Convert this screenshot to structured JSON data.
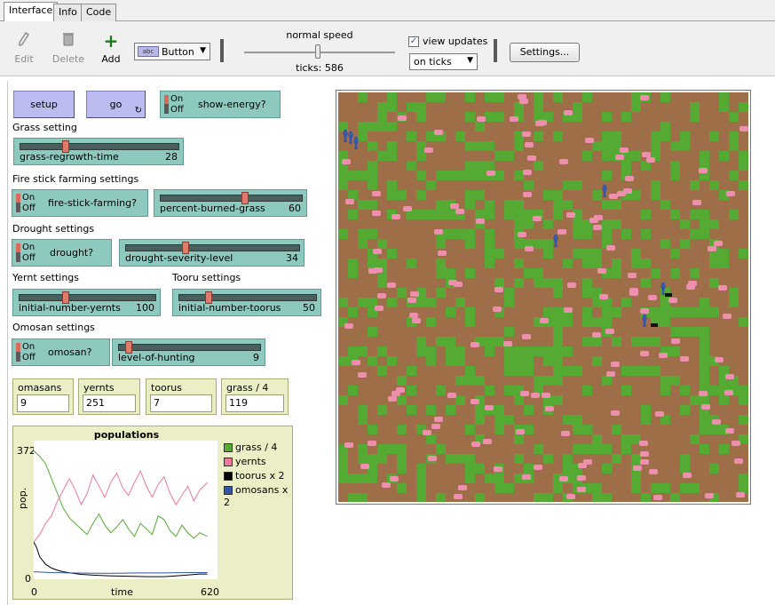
{
  "tabs": [
    {
      "label": "Interface",
      "active": true
    },
    {
      "label": "Info",
      "active": false
    },
    {
      "label": "Code",
      "active": false
    }
  ],
  "toolbar": {
    "edit_label": "Edit",
    "delete_label": "Delete",
    "add_label": "Add",
    "add_icon": "+",
    "widget_type": "Button",
    "widget_icon_text": "abc",
    "speed_label": "normal speed",
    "ticks_label": "ticks: 586",
    "view_updates_label": "view updates",
    "view_updates_checked": true,
    "update_mode": "on ticks",
    "settings_label": "Settings..."
  },
  "controls": {
    "setup_label": "setup",
    "go_label": "go",
    "show_energy": {
      "name": "show-energy?",
      "on": "On",
      "off": "Off"
    },
    "grass_note": "Grass setting",
    "grass_regrowth": {
      "name": "grass-regrowth-time",
      "value": "28",
      "fraction": 0.28
    },
    "fire_note": "Fire stick farming settings",
    "fire_stick": {
      "name": "fire-stick-farming?",
      "on": "On",
      "off": "Off"
    },
    "percent_burned": {
      "name": "percent-burned-grass",
      "value": "60",
      "fraction": 0.6
    },
    "drought_note": "Drought settings",
    "drought": {
      "name": "drought?",
      "on": "On",
      "off": "Off"
    },
    "drought_severity": {
      "name": "drought-severity-level",
      "value": "34",
      "fraction": 0.34
    },
    "yernt_note": "Yernt settings",
    "tooru_note": "Tooru settings",
    "initial_yernts": {
      "name": "initial-number-yernts",
      "value": "100",
      "fraction": 0.33
    },
    "initial_toorus": {
      "name": "initial-number-toorus",
      "value": "50",
      "fraction": 0.2
    },
    "omosan_note": "Omosan settings",
    "omosan": {
      "name": "omosan?",
      "on": "On",
      "off": "Off"
    },
    "level_hunting": {
      "name": "level-of-hunting",
      "value": "9",
      "fraction": 0.05
    }
  },
  "monitors": [
    {
      "name": "omasans",
      "value": "9"
    },
    {
      "name": "yernts",
      "value": "251"
    },
    {
      "name": "toorus",
      "value": "7"
    },
    {
      "name": "grass / 4",
      "value": "119"
    }
  ],
  "chart_data": {
    "type": "line",
    "title": "populations",
    "xlabel": "time",
    "ylabel": "pop.",
    "xlim": [
      0,
      620
    ],
    "ylim": [
      0,
      372
    ],
    "x_tick_labels": [
      "0",
      "620"
    ],
    "y_tick_labels": [
      "0",
      "372"
    ],
    "legend_position": "right",
    "series": [
      {
        "name": "grass / 4",
        "color": "#55aa33",
        "x": [
          0,
          20,
          40,
          60,
          80,
          100,
          120,
          140,
          160,
          180,
          200,
          220,
          240,
          260,
          280,
          300,
          320,
          340,
          360,
          380,
          400,
          420,
          440,
          460,
          480,
          500,
          520,
          540,
          560,
          586
        ],
        "y": [
          345,
          330,
          310,
          270,
          230,
          190,
          165,
          150,
          135,
          120,
          150,
          175,
          145,
          125,
          140,
          160,
          135,
          115,
          150,
          135,
          120,
          170,
          160,
          130,
          115,
          145,
          125,
          110,
          125,
          115
        ]
      },
      {
        "name": "yernts",
        "color": "#ee7799",
        "x": [
          0,
          20,
          40,
          60,
          80,
          100,
          120,
          140,
          160,
          180,
          200,
          220,
          240,
          260,
          280,
          300,
          320,
          340,
          360,
          380,
          400,
          420,
          440,
          460,
          480,
          500,
          520,
          540,
          560,
          586
        ],
        "y": [
          100,
          120,
          150,
          170,
          210,
          240,
          270,
          240,
          200,
          230,
          280,
          250,
          220,
          260,
          285,
          245,
          225,
          260,
          290,
          250,
          220,
          255,
          275,
          230,
          200,
          225,
          250,
          210,
          240,
          260
        ]
      },
      {
        "name": "toorus x 2",
        "color": "#000000",
        "x": [
          0,
          10,
          20,
          40,
          60,
          80,
          100,
          130,
          160,
          200,
          260,
          320,
          380,
          440,
          500,
          560,
          586
        ],
        "y": [
          100,
          85,
          60,
          40,
          30,
          24,
          20,
          16,
          13,
          11,
          9,
          8,
          7,
          7,
          10,
          14,
          14
        ]
      },
      {
        "name": "omosans x 2",
        "color": "#3355aa",
        "x": [
          0,
          60,
          120,
          200,
          280,
          360,
          440,
          520,
          586
        ],
        "y": [
          20,
          18,
          17,
          16,
          16,
          17,
          17,
          18,
          18
        ]
      }
    ]
  }
}
